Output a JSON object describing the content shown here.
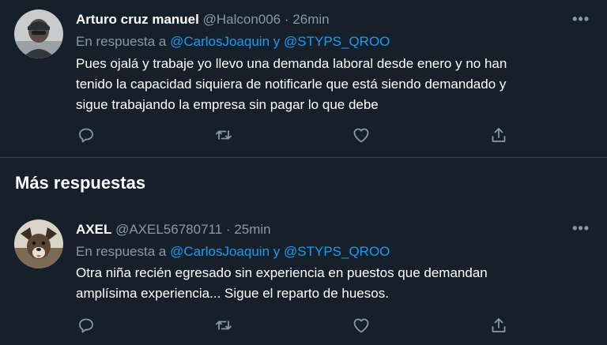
{
  "tweets": [
    {
      "name": "Arturo cruz manuel",
      "handle": "@Halcon006",
      "separator": "·",
      "time": "26min",
      "reply_prefix": "En respuesta a",
      "mention_1": "@CarlosJoaquin",
      "reply_joiner": "y",
      "mention_2": "@STYPS_QROO",
      "text_lines": [
        "Pues ojalá y trabaje yo llevo una demanda laboral desde enero y no han",
        "tenido la capacidad siquiera de notificarle que está siendo demandado y",
        "sigue trabajando la empresa sin pagar lo que debe"
      ],
      "more_label": "•••"
    },
    {
      "name": "AXEL",
      "handle": "@AXEL56780711",
      "separator": "·",
      "time": "25min",
      "reply_prefix": "En respuesta a",
      "mention_1": "@CarlosJoaquin",
      "reply_joiner": "y",
      "mention_2": "@STYPS_QROO",
      "text_lines": [
        "Otra niña recién egresado sin experiencia en puestos que demandan",
        "amplísima experiencia... Sigue el reparto de huesos."
      ],
      "more_label": "•••"
    }
  ],
  "section_title": "Más respuestas",
  "icons": {
    "reply": "reply-icon",
    "retweet": "retweet-icon",
    "like": "like-icon",
    "share": "share-icon",
    "more": "more-icon"
  },
  "colors": {
    "background": "#15202b",
    "text": "#ffffff",
    "secondary": "#8b98a5",
    "link": "#1d9bf0",
    "divider": "#38444d"
  }
}
